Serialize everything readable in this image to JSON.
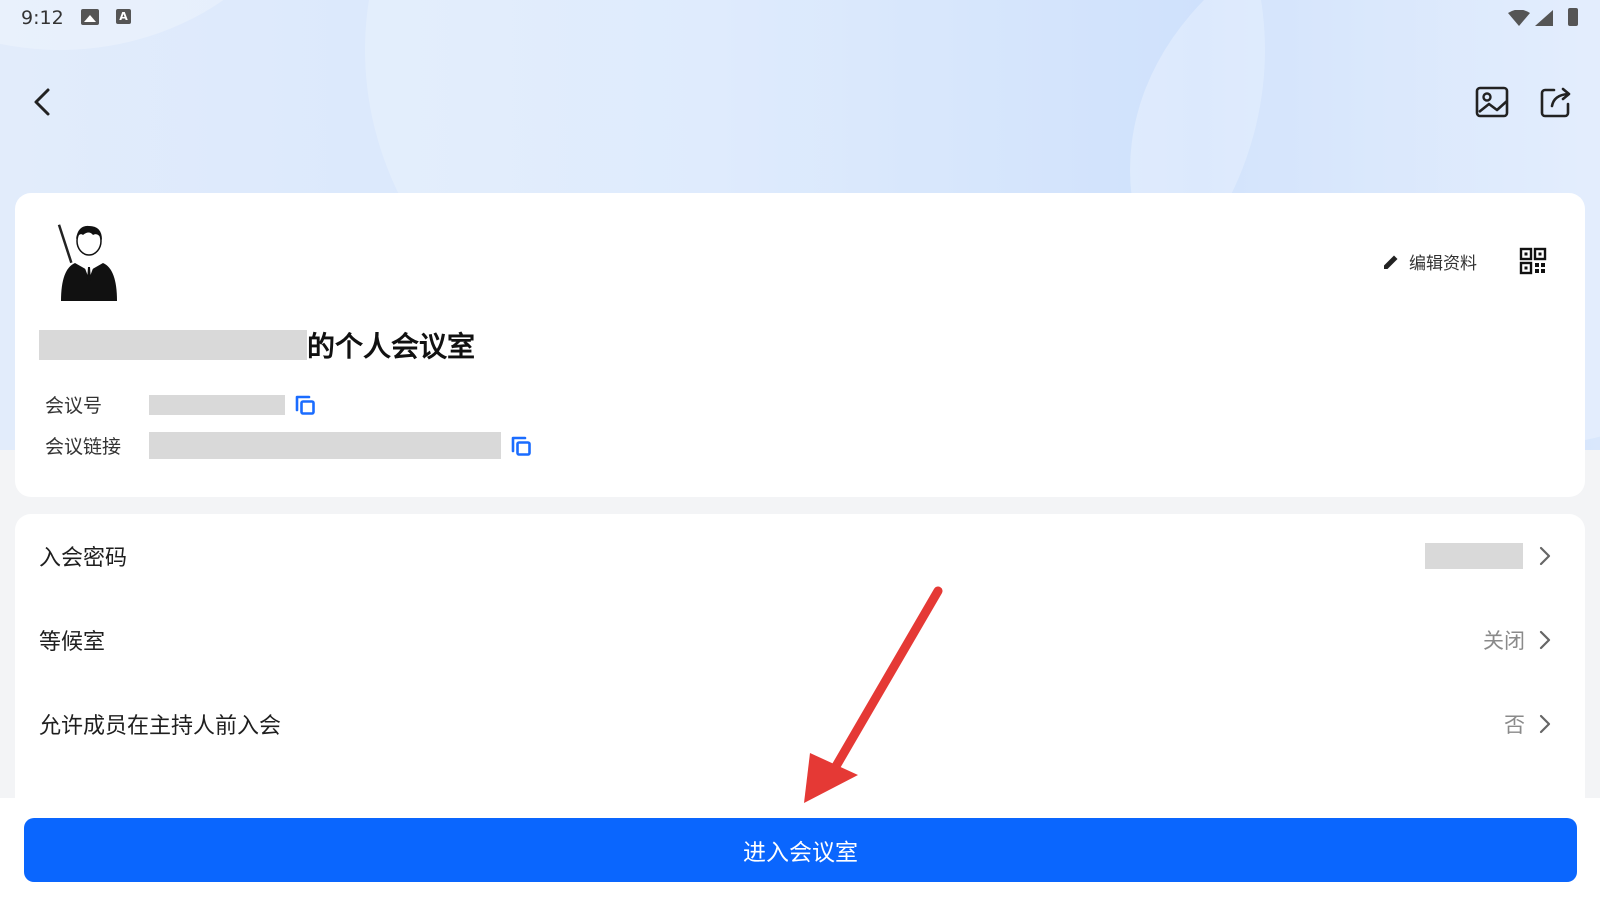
{
  "status_bar": {
    "time": "9:12",
    "icons": [
      "image-icon",
      "a-icon",
      "wifi-icon",
      "signal-icon",
      "battery-icon"
    ]
  },
  "header": {
    "back_icon": "chevron-left-icon",
    "image_icon": "image-icon",
    "share_icon": "share-icon"
  },
  "profile": {
    "edit_label": "编辑资料",
    "title_suffix": "的个人会议室",
    "meeting_id_label": "会议号",
    "meeting_link_label": "会议链接"
  },
  "settings": {
    "items": [
      {
        "label": "入会密码",
        "value": ""
      },
      {
        "label": "等候室",
        "value": "关闭"
      },
      {
        "label": "允许成员在主持人前入会",
        "value": "否"
      }
    ]
  },
  "action": {
    "enter_label": "进入会议室"
  },
  "colors": {
    "primary": "#0a66fe",
    "annotation_arrow": "#e53935",
    "copy_icon": "#1a6cff"
  }
}
